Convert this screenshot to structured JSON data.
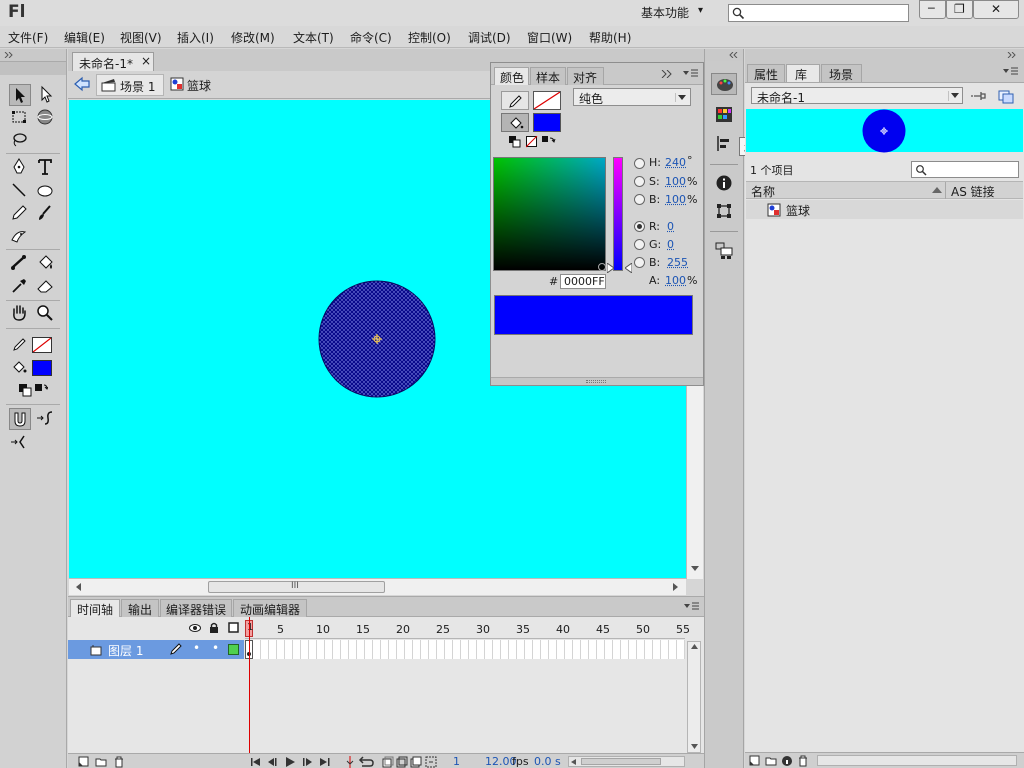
{
  "app": {
    "logo": "Fl",
    "workspace": "基本功能",
    "workspace_arrow": "▾"
  },
  "window_controls": {
    "minimize": "─",
    "restore": "❐",
    "close": "✕"
  },
  "menu": [
    "文件(F)",
    "编辑(E)",
    "视图(V)",
    "插入(I)",
    "修改(M)",
    "文本(T)",
    "命令(C)",
    "控制(O)",
    "调试(D)",
    "窗口(W)",
    "帮助(H)"
  ],
  "doc_tab": {
    "name": "未命名-1*",
    "close": "×"
  },
  "breadcrumb": {
    "scene": "场景 1",
    "symbol": "篮球"
  },
  "color_panel": {
    "tabs": [
      "颜色",
      "样本",
      "对齐"
    ],
    "fill_type": "纯色",
    "hsb": {
      "h_label": "H:",
      "h": "240",
      "h_unit": "°",
      "s_label": "S:",
      "s": "100",
      "s_unit": "%",
      "b_label": "B:",
      "b": "100",
      "b_unit": "%"
    },
    "rgb": {
      "r_label": "R:",
      "r": "0",
      "g_label": "G:",
      "g": "0",
      "b_label": "B:",
      "b": "255"
    },
    "hex_label": "#",
    "hex": "0000FF",
    "alpha_label": "A:",
    "alpha": "100",
    "alpha_unit": "%",
    "fill_color": "#0000FF"
  },
  "tooltip": "样本",
  "right_panel": {
    "tabs": [
      "属性",
      "库",
      "场景"
    ],
    "library_doc": "未命名-1",
    "item_count": "1 个项目",
    "columns": {
      "name": "名称",
      "linkage": "AS 链接"
    },
    "items": [
      "篮球"
    ]
  },
  "timeline": {
    "tabs": [
      "时间轴",
      "输出",
      "编译器错误",
      "动画编辑器"
    ],
    "layer": "图层 1",
    "frame_numbers": [
      "1",
      "5",
      "10",
      "15",
      "20",
      "25",
      "30",
      "35",
      "40",
      "45",
      "50",
      "55"
    ],
    "current_frame": "1",
    "fps": "12.00",
    "fps_unit": "fps",
    "time": "0.0 s"
  },
  "stage": {
    "background": "#00FFFF",
    "ball_color": "#0A0A8C"
  },
  "scrollbar_grip": "III"
}
